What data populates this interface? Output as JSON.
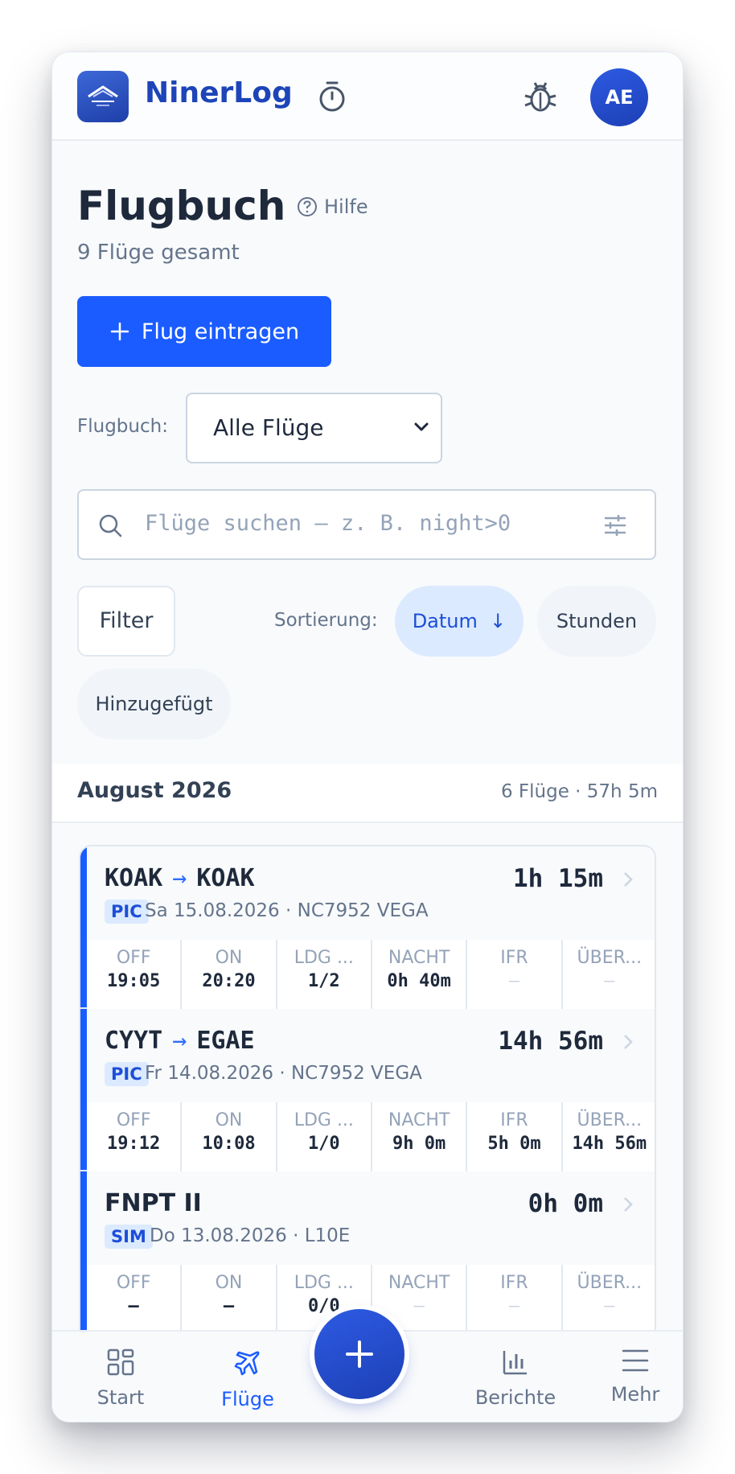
{
  "app": {
    "brand": "NinerLog",
    "avatar_initials": "AE"
  },
  "page": {
    "title": "Flugbuch",
    "help_label": "Hilfe",
    "subtitle": "9 Flüge gesamt",
    "add_button_label": "Flug eintragen",
    "logbook_label": "Flugbuch:",
    "logbook_selected": "Alle Flüge",
    "search_placeholder": "Flüge suchen — z. B. night>0",
    "filter_label": "Filter",
    "sort_label": "Sortierung:",
    "sort_options": {
      "date": "Datum",
      "hours": "Stunden",
      "added": "Hinzugefügt"
    }
  },
  "month_group": {
    "title": "August 2026",
    "meta": "6 Flüge · 57h 5m"
  },
  "flights": [
    {
      "from": "KOAK",
      "to": "KOAK",
      "duration": "1h 15m",
      "role": "PIC",
      "info": "Sa 15.08.2026 · NC7952 VEGA",
      "cells": [
        {
          "label": "OFF",
          "value": "19:05"
        },
        {
          "label": "ON",
          "value": "20:20"
        },
        {
          "label": "LDG ...",
          "value": "1/2"
        },
        {
          "label": "NACHT",
          "value": "0h 40m"
        },
        {
          "label": "IFR",
          "value": "–"
        },
        {
          "label": "ÜBER...",
          "value": "–"
        }
      ]
    },
    {
      "from": "CYYT",
      "to": "EGAE",
      "duration": "14h 56m",
      "role": "PIC",
      "info": "Fr 14.08.2026 · NC7952 VEGA",
      "cells": [
        {
          "label": "OFF",
          "value": "19:12"
        },
        {
          "label": "ON",
          "value": "10:08"
        },
        {
          "label": "LDG ...",
          "value": "1/0"
        },
        {
          "label": "NACHT",
          "value": "9h 0m"
        },
        {
          "label": "IFR",
          "value": "5h 0m"
        },
        {
          "label": "ÜBER...",
          "value": "14h 56m"
        }
      ]
    },
    {
      "from": "FNPT II",
      "to": "",
      "duration": "0h 0m",
      "role": "SIM",
      "info": "Do 13.08.2026 · L10E",
      "cells": [
        {
          "label": "OFF",
          "value": "–"
        },
        {
          "label": "ON",
          "value": "–"
        },
        {
          "label": "LDG ...",
          "value": "0/0"
        },
        {
          "label": "NACHT",
          "value": "–"
        },
        {
          "label": "IFR",
          "value": "–"
        },
        {
          "label": "ÜBER...",
          "value": "–"
        }
      ]
    }
  ],
  "bottom_nav": {
    "start": "Start",
    "flights": "Flüge",
    "reports": "Berichte",
    "more": "Mehr"
  },
  "colors": {
    "primary": "#1a5cff",
    "brand": "#1d44b8",
    "chip_active_bg": "#dbeafe"
  }
}
